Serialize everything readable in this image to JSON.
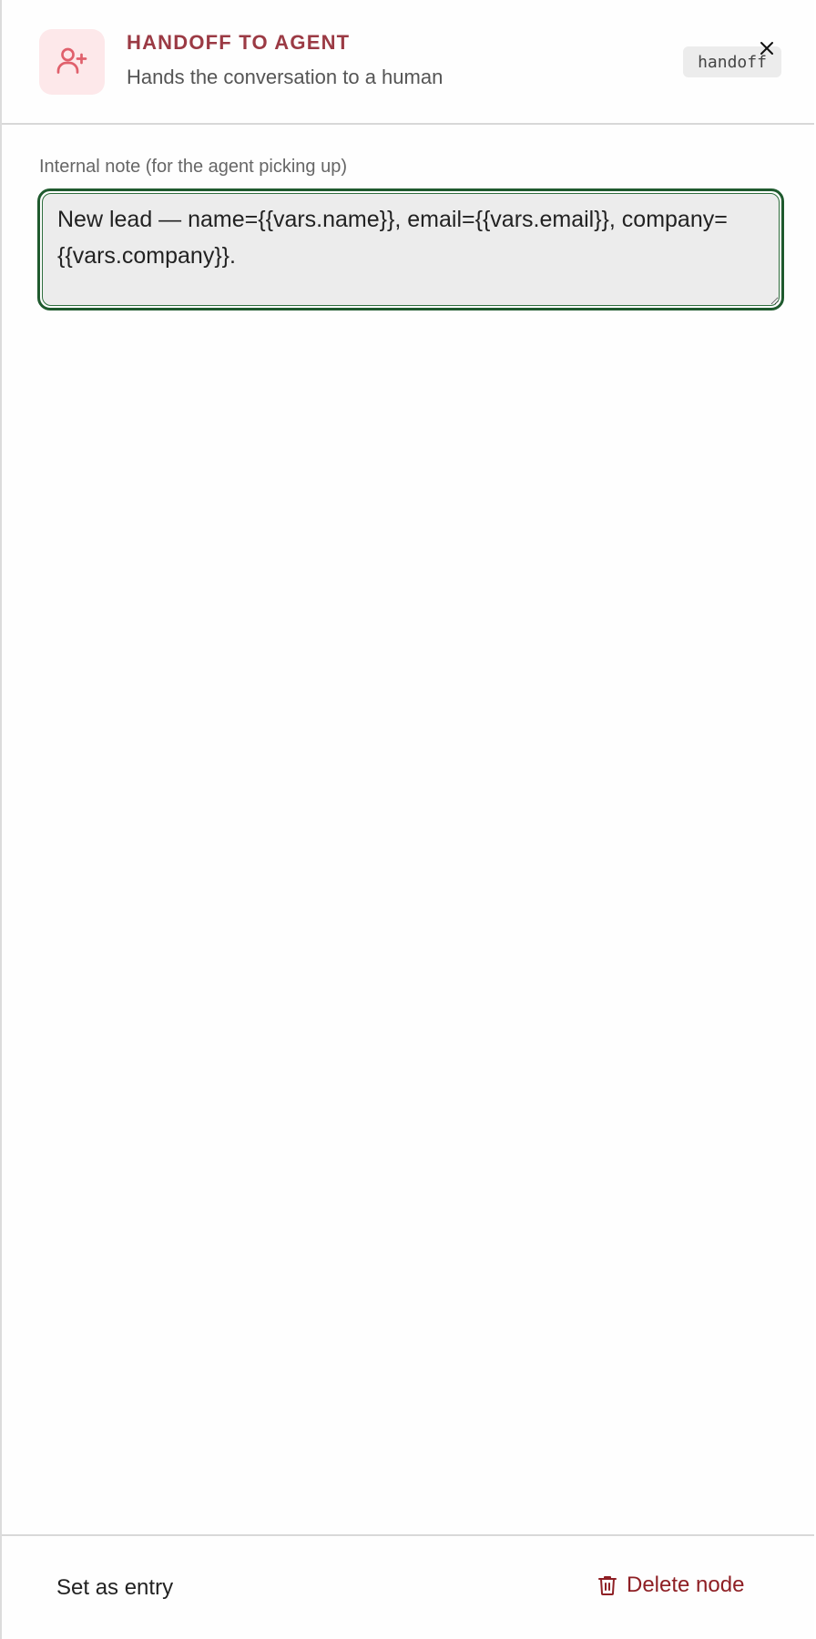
{
  "header": {
    "title": "HANDOFF TO AGENT",
    "subtitle": "Hands the conversation to a human",
    "type_tag": "handoff",
    "node_icon": "user-plus-icon",
    "close_icon": "close-icon"
  },
  "note_field": {
    "label": "Internal note (for the agent picking up)",
    "value": "New lead — name={{vars.name}}, email={{vars.email}}, company={{vars.company}}."
  },
  "footer": {
    "set_entry_label": "Set as entry",
    "delete_label": "Delete node",
    "delete_icon": "trash-icon"
  },
  "colors": {
    "accent": "#9b3a44",
    "icon_bg": "#fde8ea",
    "focus_border": "#1f5a2e",
    "danger": "#8e1f24"
  }
}
